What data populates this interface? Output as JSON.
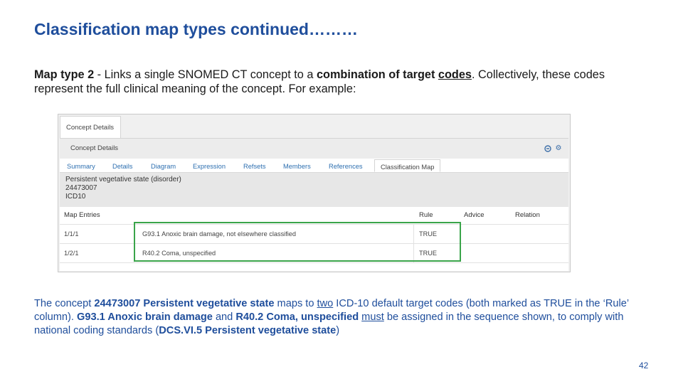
{
  "slide": {
    "title": "Classification map types continued………",
    "intro": {
      "p1": "Map type 2",
      "p2": " - Links a single SNOMED CT concept to a ",
      "p3": "combination of target ",
      "p4": "codes",
      "p5": ". Collectively, these codes represent the full clinical meaning of the concept. For example:"
    },
    "body": {
      "t1": "The concept ",
      "t2": "24473007 Persistent vegetative state",
      "t3": " maps to ",
      "t4": "two",
      "t5": " ICD-10 default target codes (both marked as TRUE in the ‘Rule’ column). ",
      "t6": "G93.1 Anoxic brain damage",
      "t7": " and ",
      "t8": "R40.2 Coma, unspecified",
      "t9": " ",
      "t10": "must",
      "t11": " be assigned in the sequence shown, to comply with national coding standards (",
      "t12": "DCS.VI.5 Persistent vegetative state",
      "t13": ")"
    },
    "page_number": "42"
  },
  "screenshot": {
    "outer_tab": "Concept Details",
    "panel_title": "Concept Details",
    "icons": [
      "minus-circle-icon",
      "gear-icon"
    ],
    "tabs": [
      "Summary",
      "Details",
      "Diagram",
      "Expression",
      "Refsets",
      "Members",
      "References",
      "Classification Map"
    ],
    "active_tab": "Classification Map",
    "concept": {
      "name": "Persistent vegetative state (disorder)",
      "id": "24473007",
      "map": "ICD10"
    },
    "table": {
      "headers": [
        "Map Entries",
        "Rule",
        "Advice",
        "Relation"
      ],
      "rows": [
        {
          "entry": "1/1/1",
          "target": "G93.1 Anoxic brain damage, not elsewhere classified",
          "rule": "TRUE"
        },
        {
          "entry": "1/2/1",
          "target": "R40.2 Coma, unspecified",
          "rule": "TRUE"
        }
      ]
    },
    "highlight_color": "#3aa44a"
  }
}
